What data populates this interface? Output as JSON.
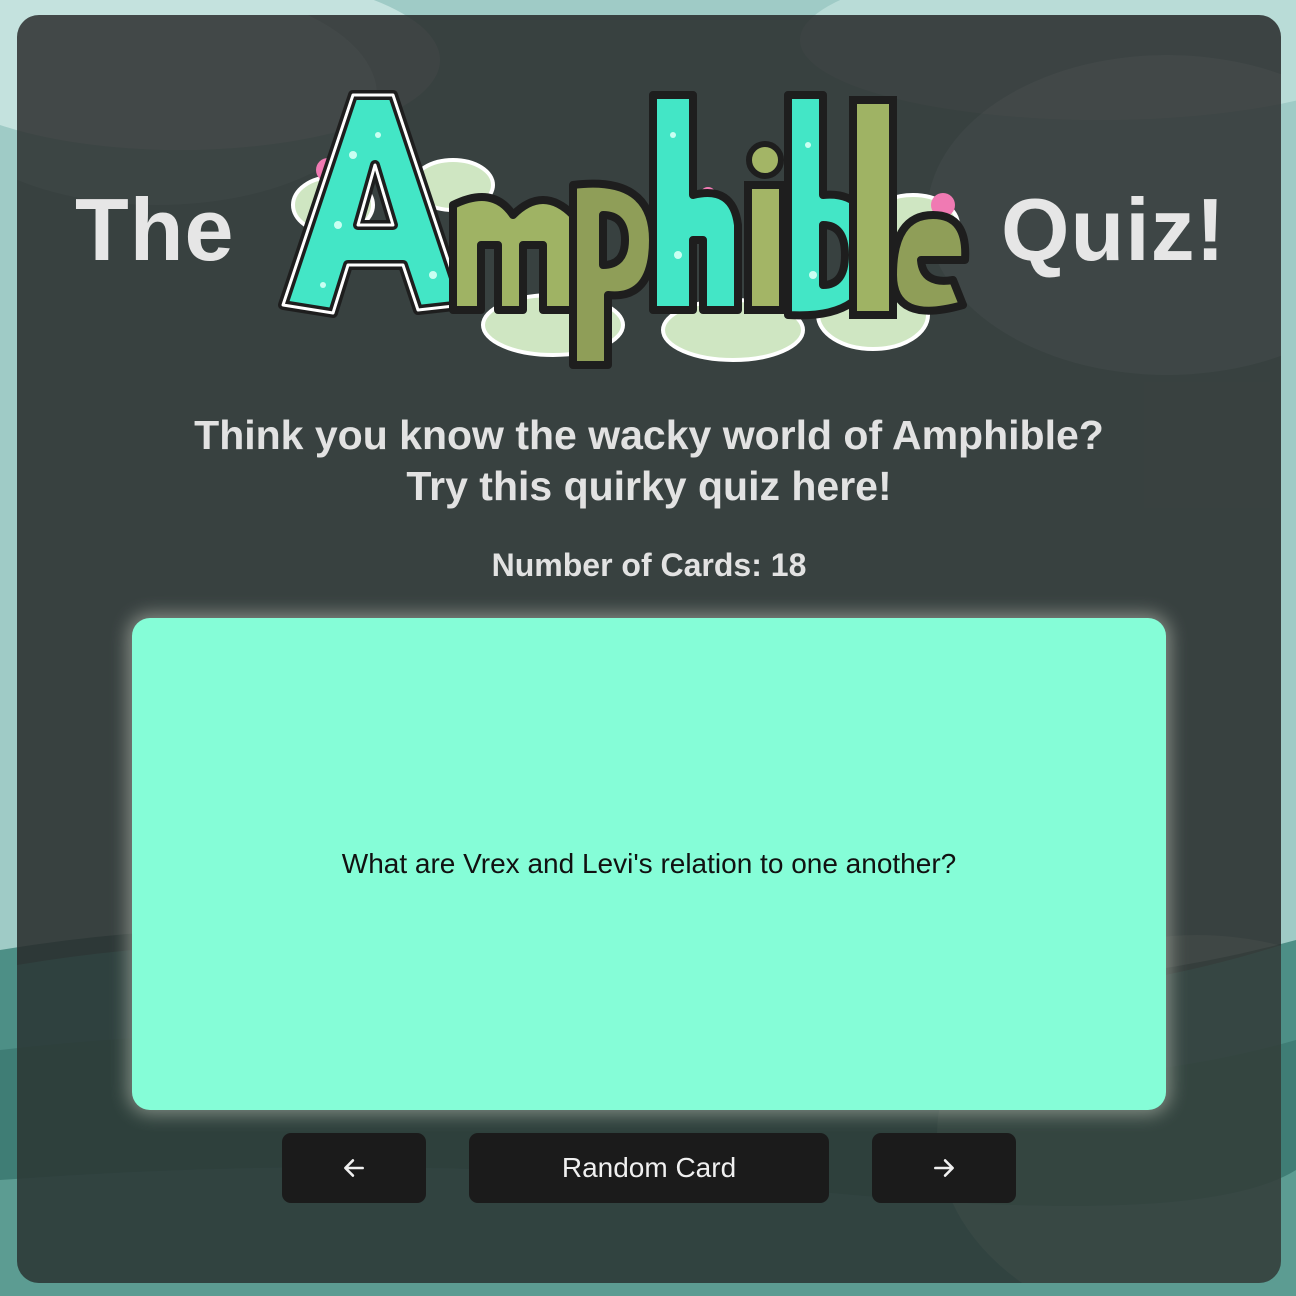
{
  "header": {
    "title_prefix": "The",
    "logo_wordmark": "Amphible",
    "title_suffix": "Quiz!"
  },
  "intro": {
    "line1": "Think you know the wacky world of Amphible?",
    "line2": "Try this quirky quiz here!"
  },
  "deck": {
    "count_label": "Number of Cards: 18"
  },
  "card": {
    "question": "What are Vrex and Levi's relation to one another?"
  },
  "controls": {
    "prev_icon": "arrow-left-icon",
    "random_label": "Random Card",
    "next_icon": "arrow-right-icon"
  },
  "colors": {
    "card_background": "#85fdd7",
    "panel_background": "#2a2c2c",
    "button_background": "#1b1b1b",
    "logo_teal": "#3ee6c4",
    "logo_olive": "#9aa560"
  }
}
